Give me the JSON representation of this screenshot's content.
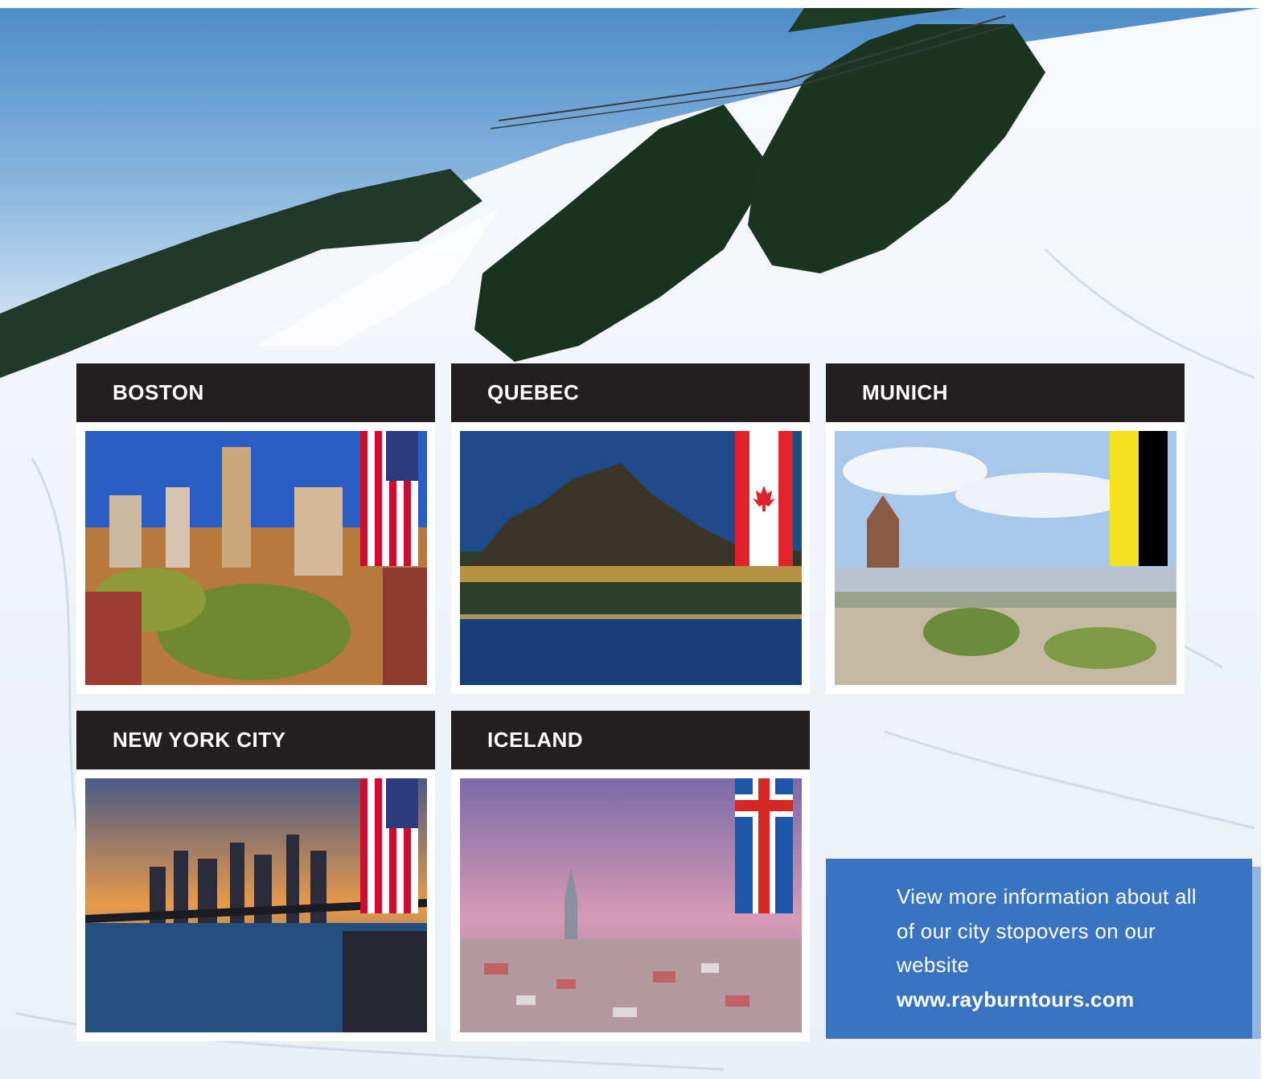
{
  "cities": [
    {
      "name": "BOSTON",
      "flag": "usa-flag-icon"
    },
    {
      "name": "QUEBEC",
      "flag": "canada-flag-icon"
    },
    {
      "name": "MUNICH",
      "flag": "munich-flag-icon"
    },
    {
      "name": "NEW YORK CITY",
      "flag": "usa-flag-icon"
    },
    {
      "name": "ICELAND",
      "flag": "iceland-flag-icon"
    }
  ],
  "info": {
    "text": "View more information about all of our city stopovers on our website",
    "url": "www.rayburntours.com"
  },
  "colors": {
    "header_bg": "#231f20",
    "info_bg": "#3a74c0",
    "frame": "#ffffff"
  }
}
